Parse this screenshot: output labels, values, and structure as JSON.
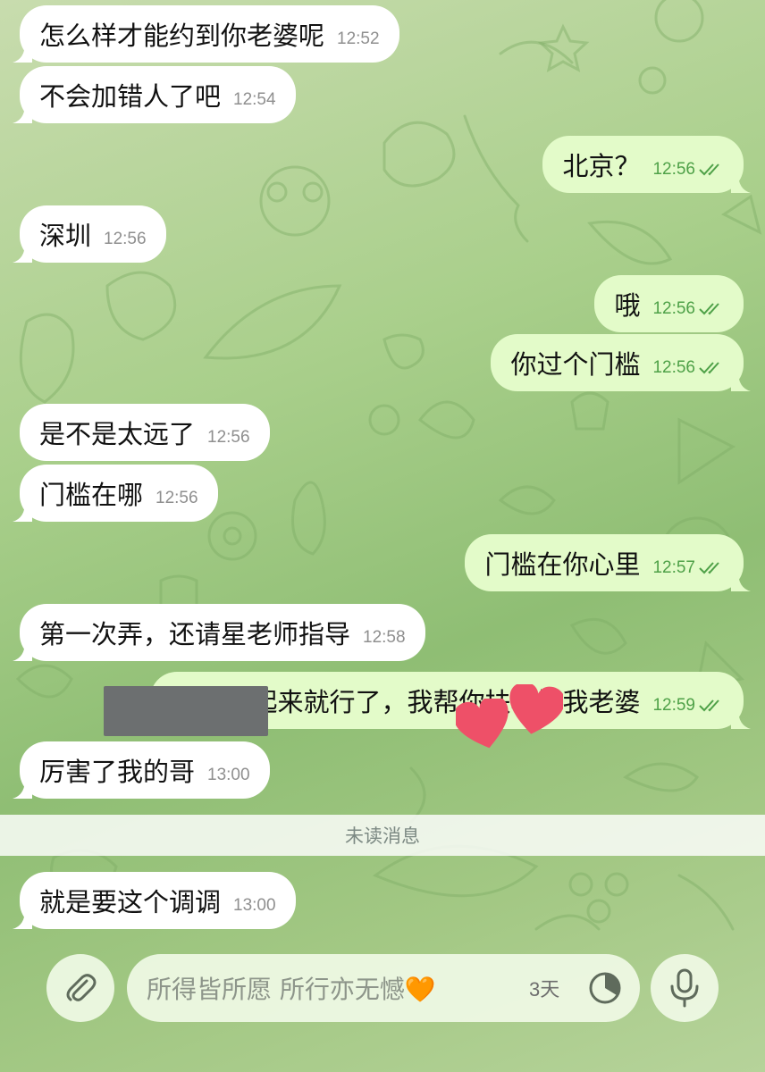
{
  "messages": [
    {
      "side": "in",
      "text": "怎么样才能约到你老婆呢",
      "time": "12:52"
    },
    {
      "side": "in",
      "text": "不会加错人了吧",
      "time": "12:54"
    },
    {
      "side": "out",
      "text": "北京？",
      "time": "12:56"
    },
    {
      "side": "in",
      "text": "深圳",
      "time": "12:56"
    },
    {
      "side": "out",
      "text": "哦",
      "time": "12:56"
    },
    {
      "side": "out",
      "text": "你过个门槛",
      "time": "12:56"
    },
    {
      "side": "in",
      "text": "是不是太远了",
      "time": "12:56"
    },
    {
      "side": "in",
      "text": "门槛在哪",
      "time": "12:56"
    },
    {
      "side": "out",
      "text": "门槛在你心里",
      "time": "12:57"
    },
    {
      "side": "in",
      "text": "第一次弄，还请星老师指导",
      "time": "12:58"
    },
    {
      "side": "out",
      "text": "鸡巴硬起来就行了，我帮你扶着操我老婆",
      "time": "12:59"
    },
    {
      "side": "in",
      "text": "厉害了我的哥",
      "time": "13:00"
    },
    {
      "side": "in",
      "text": "就是要这个调调",
      "time": "13:00"
    }
  ],
  "unread_divider": "未读消息",
  "composer": {
    "placeholder": "所得皆所愿 所行亦无憾🧡",
    "timer_label": "3天"
  },
  "icons": {
    "attach": "paperclip-icon",
    "timer": "self-destruct-timer-icon",
    "mic": "microphone-icon",
    "read_receipt": "double-check-icon"
  },
  "colors": {
    "incoming_bubble": "#ffffff",
    "outgoing_bubble": "#e3fbc9",
    "outgoing_time": "#4fa148",
    "heart": "#ee5068"
  }
}
